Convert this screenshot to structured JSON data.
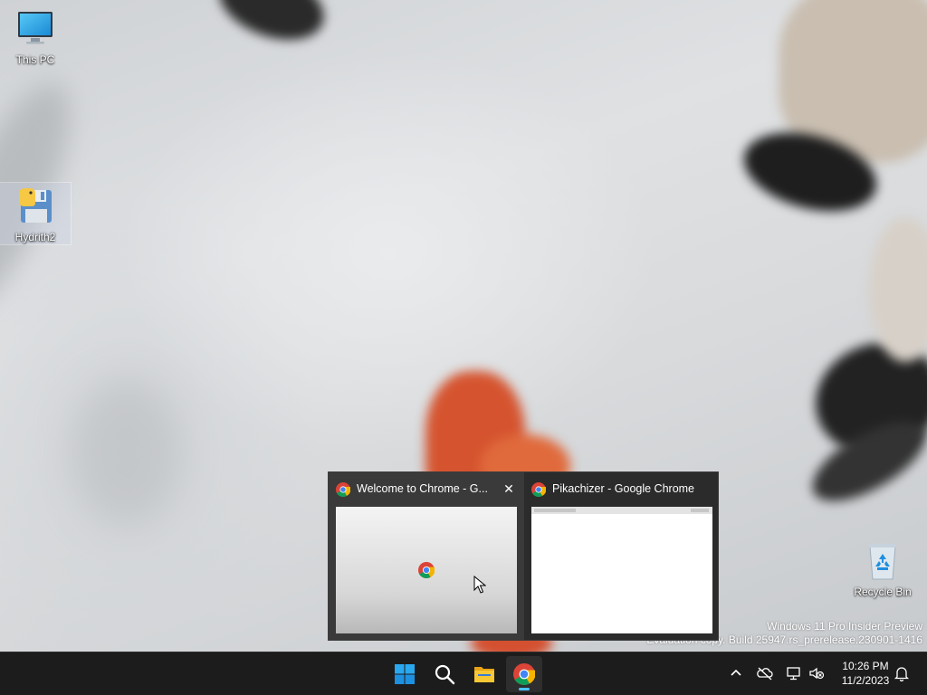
{
  "desktop": {
    "icons": [
      {
        "label": "This PC",
        "icon": "monitor-icon"
      },
      {
        "label": "Hydrith2",
        "icon": "floppy-python-icon"
      },
      {
        "label": "Recycle Bin",
        "icon": "recycle-bin-icon"
      }
    ],
    "watermark": {
      "line1": "Windows 11 Pro Insider Preview",
      "line2": "Evaluation copy. Build 25947.rs_prerelease.230901-1416"
    }
  },
  "taskbar_preview": {
    "thumbnails": [
      {
        "title": "Welcome to Chrome - G...",
        "icon": "chrome-icon",
        "close_label": "✕",
        "active": true
      },
      {
        "title": "Pikachizer - Google Chrome",
        "icon": "chrome-icon",
        "active": false
      }
    ]
  },
  "taskbar": {
    "apps": [
      {
        "name": "Start",
        "icon": "windows-start-icon"
      },
      {
        "name": "Search",
        "icon": "search-icon"
      },
      {
        "name": "File Explorer",
        "icon": "folder-icon"
      },
      {
        "name": "Google Chrome",
        "icon": "chrome-icon",
        "running": true
      }
    ],
    "tray": {
      "icons": [
        "chevron-up-icon",
        "onedrive-offline-icon",
        "network-icon",
        "volume-muted-icon",
        "notification-bell-icon"
      ],
      "time": "10:26 PM",
      "date": "11/2/2023"
    }
  },
  "colors": {
    "taskbar_bg": "#1c1c1c",
    "accent": "#4cc2ff",
    "popup_bg": "#2b2b2b"
  }
}
